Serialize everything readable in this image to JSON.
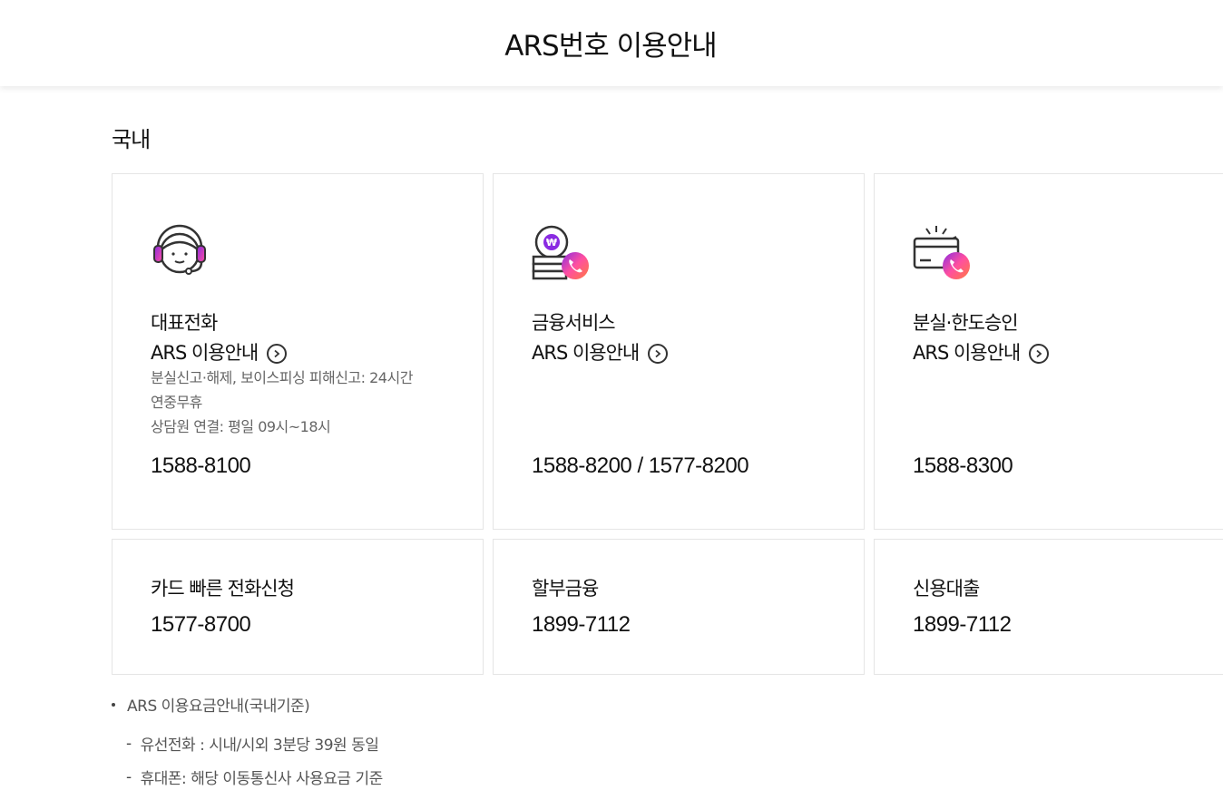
{
  "header": {
    "title": "ARS번호 이용안내"
  },
  "section": {
    "title": "국내"
  },
  "cards": [
    {
      "title": "대표전화",
      "subtitle": "ARS 이용안내",
      "desc1": "분실신고·해제, 보이스피싱 피해신고: 24시간",
      "desc2": "연중무휴",
      "desc3": "상담원 연결: 평일 09시~18시",
      "number": "1588-8100",
      "icon": "headset-agent-icon"
    },
    {
      "title": "금융서비스",
      "subtitle": "ARS 이용안내",
      "number": "1588-8200 / 1577-8200",
      "icon": "won-coin-phone-icon"
    },
    {
      "title": "분실·한도승인",
      "subtitle": "ARS 이용안내",
      "number": "1588-8300",
      "icon": "card-phone-icon"
    }
  ],
  "small_cards": [
    {
      "title": "카드 빠른 전화신청",
      "number": "1577-8700"
    },
    {
      "title": "할부금융",
      "number": "1899-7112"
    },
    {
      "title": "신용대출",
      "number": "1899-7112"
    }
  ],
  "notes": {
    "heading": "ARS 이용요금안내(국내기준)",
    "items": [
      "유선전화 : 시내/시외 3분당 39원 동일",
      "휴대폰: 해당 이동통신사 사용요금 기준"
    ]
  },
  "colors": {
    "accent_purple": "#8a2be2",
    "accent_orange": "#ff7a3d",
    "accent_pink": "#ff4fa0"
  }
}
